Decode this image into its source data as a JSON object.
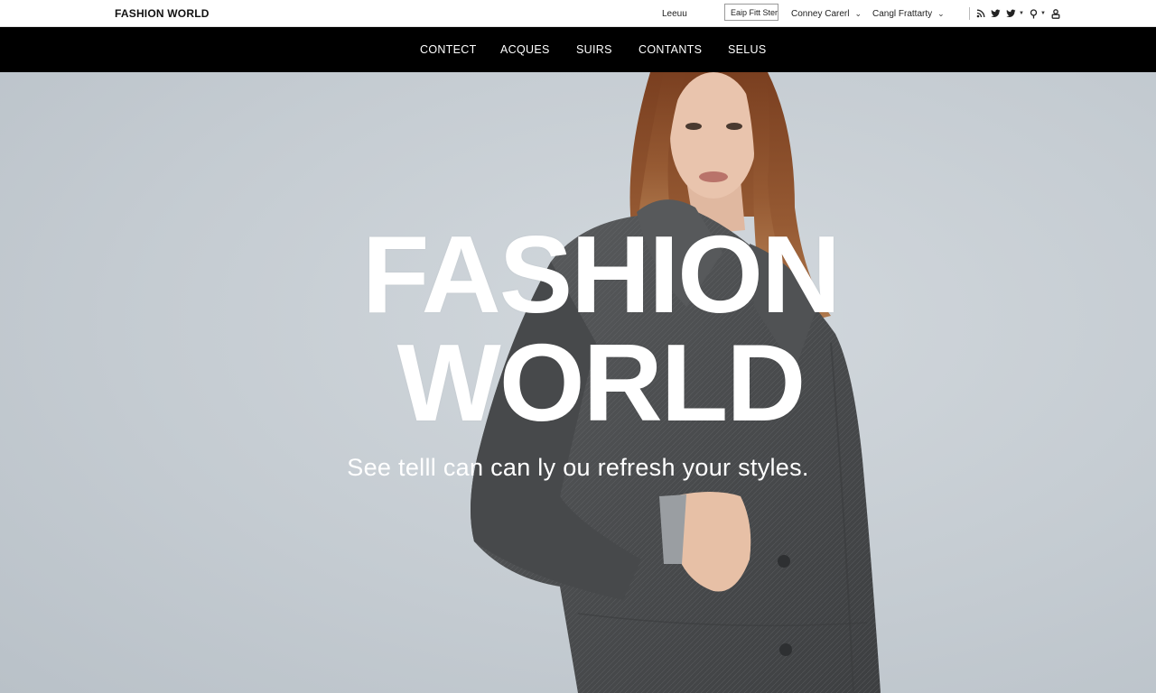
{
  "header": {
    "brand": "FASHION WORLD",
    "login": "Leeuu",
    "select_value": "Eaip Fitt Stert",
    "country": "Conney Carerl",
    "currency": "Cangl Frattarty",
    "social_icons": [
      "rss-icon",
      "twitter-icon",
      "twitter-icon",
      "location-pin-icon",
      "user-icon"
    ]
  },
  "nav": {
    "items": [
      "CONTECT",
      "ACQUES",
      "SUIRS",
      "CONTANTS",
      "SELUS"
    ]
  },
  "hero": {
    "title_line1": "FASHION",
    "title_line2": "WORLD",
    "subtitle": "See telll can can ly ou refresh your styles."
  },
  "colors": {
    "navbar": "#000000",
    "hero_background": "#c7ced4",
    "coat": "#4f5153",
    "hair": "#8a4a26"
  }
}
